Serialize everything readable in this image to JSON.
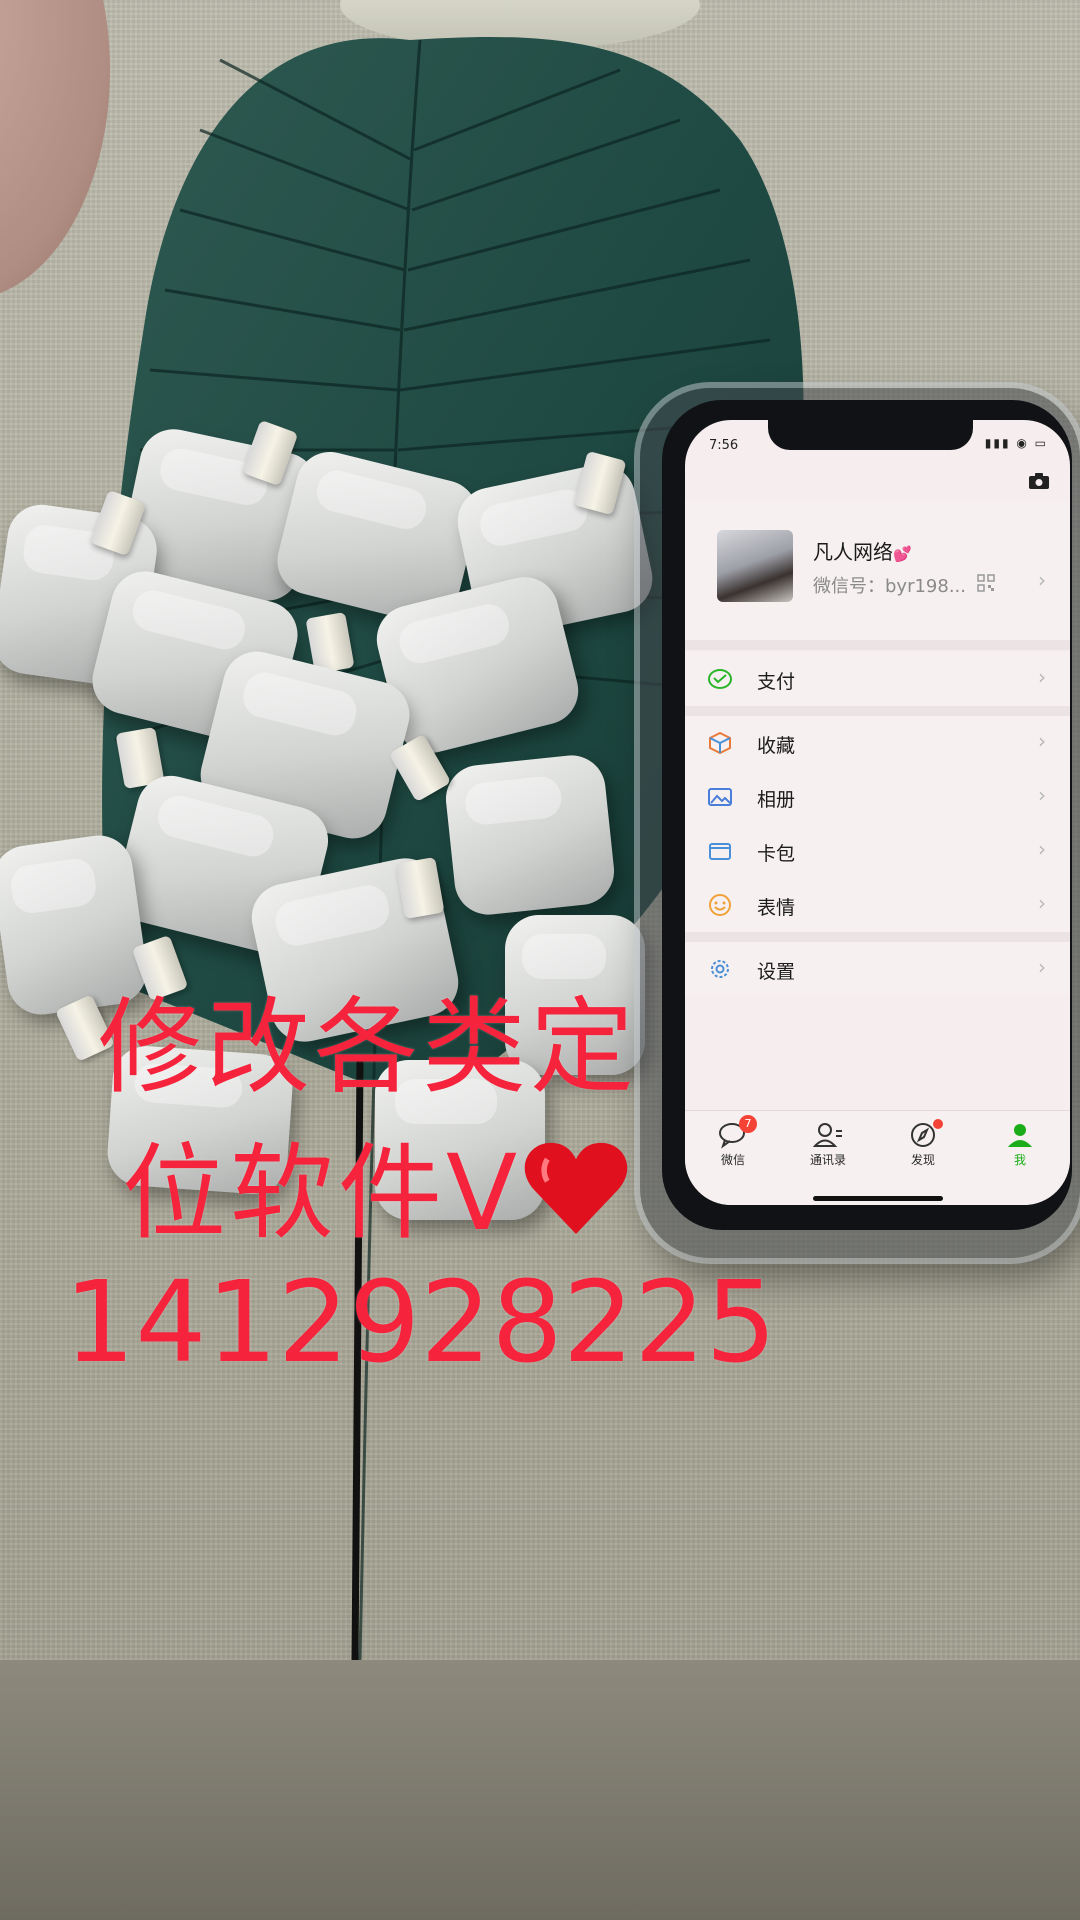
{
  "phone": {
    "status_time": "7:56",
    "nickname": "凡人网络",
    "wechat_id": "微信号：byr198...",
    "menu": [
      {
        "label": "支付",
        "icon": "pay-icon"
      },
      {
        "label": "收藏",
        "icon": "favorites-icon"
      },
      {
        "label": "相册",
        "icon": "album-icon"
      },
      {
        "label": "卡包",
        "icon": "card-wallet-icon"
      },
      {
        "label": "表情",
        "icon": "emoji-icon"
      },
      {
        "label": "设置",
        "icon": "gear-icon"
      }
    ],
    "tabs": [
      {
        "label": "微信",
        "icon": "chat-bubble-icon",
        "badge": "7"
      },
      {
        "label": "通讯录",
        "icon": "contacts-icon"
      },
      {
        "label": "发现",
        "icon": "compass-icon"
      },
      {
        "label": "我",
        "icon": "person-icon"
      }
    ],
    "accent_color": "#1aad19"
  },
  "overlay": {
    "line1": "修改各类定",
    "line2": "位软件V",
    "line3": "1412928225",
    "color": "#f5233b"
  }
}
